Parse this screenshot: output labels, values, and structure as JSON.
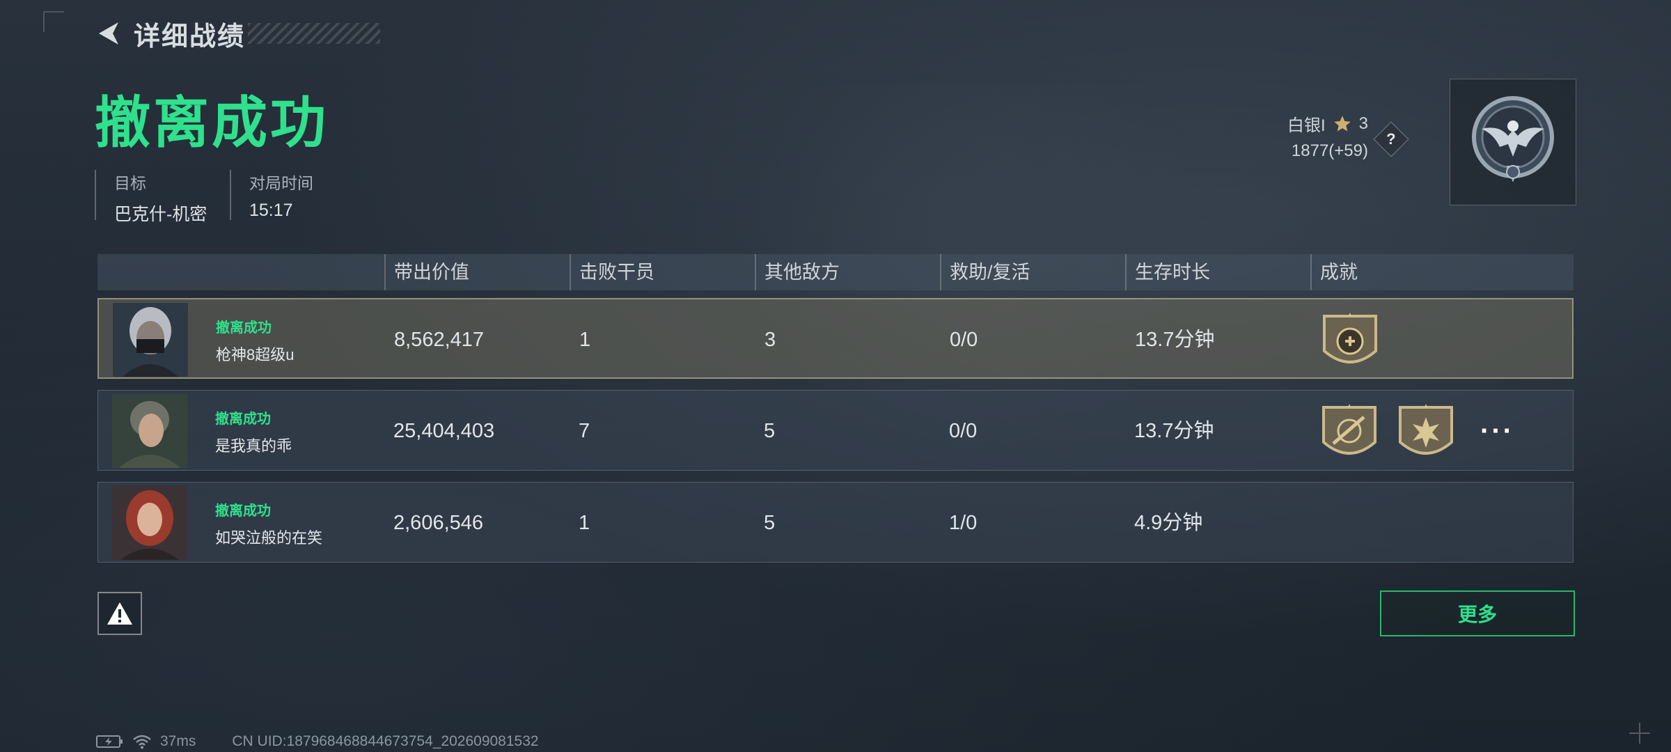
{
  "header": {
    "title": "详细战绩"
  },
  "result": {
    "title": "撤离成功"
  },
  "info": {
    "target_label": "目标",
    "target_value": "巴克什-机密",
    "time_label": "对局时间",
    "time_value": "15:17"
  },
  "rank": {
    "tier": "白银I",
    "stars": "3",
    "score": "1877(+59)",
    "help": "?"
  },
  "table": {
    "columns": [
      "带出价值",
      "击败干员",
      "其他敌方",
      "救助/复活",
      "生存时长",
      "成就"
    ],
    "rows": [
      {
        "status": "撤离成功",
        "name": "枪神8超级u",
        "value": "8,562,417",
        "kills": "1",
        "others": "3",
        "assist": "0/0",
        "survival": "13.7分钟"
      },
      {
        "status": "撤离成功",
        "name": "是我真的乖",
        "value": "25,404,403",
        "kills": "7",
        "others": "5",
        "assist": "0/0",
        "survival": "13.7分钟"
      },
      {
        "status": "撤离成功",
        "name": "如哭泣般的在笑",
        "value": "2,606,546",
        "kills": "1",
        "others": "5",
        "assist": "1/0",
        "survival": "4.9分钟"
      }
    ]
  },
  "buttons": {
    "more": "更多",
    "more_dots": "···"
  },
  "footer": {
    "latency": "37ms",
    "uid": "CN UID:1879684688446737​54_202609081532"
  },
  "colors": {
    "accent_green": "#2fe08c",
    "highlight_row": "#6e6c5c"
  }
}
